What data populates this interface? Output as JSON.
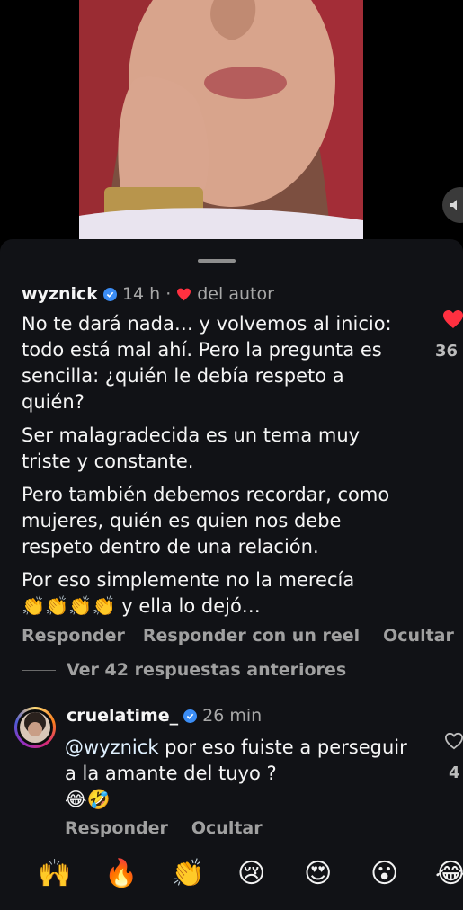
{
  "video": {
    "mute_icon": "speaker-muted-icon"
  },
  "comment1": {
    "username": "wyznick",
    "time": "14 h",
    "dot": "·",
    "author_badge": "del autor",
    "paragraphs": [
      "No te dará nada… y volvemos al inicio: todo está mal ahí. Pero la pregunta es sencilla: ¿quién le debía respeto a quién?",
      "Ser malagradecida es un tema muy triste y constante.",
      "Pero también debemos recordar, como mujeres, quién es quien nos debe respeto dentro de una relación."
    ],
    "last_line_prefix": "Por eso simplemente no la merecía",
    "clap_emojis": "👏👏👏👏",
    "last_line_suffix": "y ella lo dejó…",
    "like_count": "36",
    "actions": [
      "Responder",
      "Responder con un reel",
      "Ocultar"
    ],
    "view_replies": "Ver 42 respuestas anteriores"
  },
  "comment2": {
    "username": "cruelatime_",
    "time": "26 min",
    "mention": "@wyznick",
    "text_after_mention": " por eso fuiste a perseguir a la amante del tuyo ?",
    "emojis": "😂🤣",
    "like_count": "4",
    "actions": [
      "Responder",
      "Ocultar"
    ]
  },
  "reactions": [
    "🙌",
    "🔥",
    "👏",
    "😢",
    "😍",
    "😮",
    "😂"
  ],
  "colors": {
    "like_red": "#ff3040",
    "verified_blue": "#3b8df5",
    "sheet_bg": "#111216"
  }
}
